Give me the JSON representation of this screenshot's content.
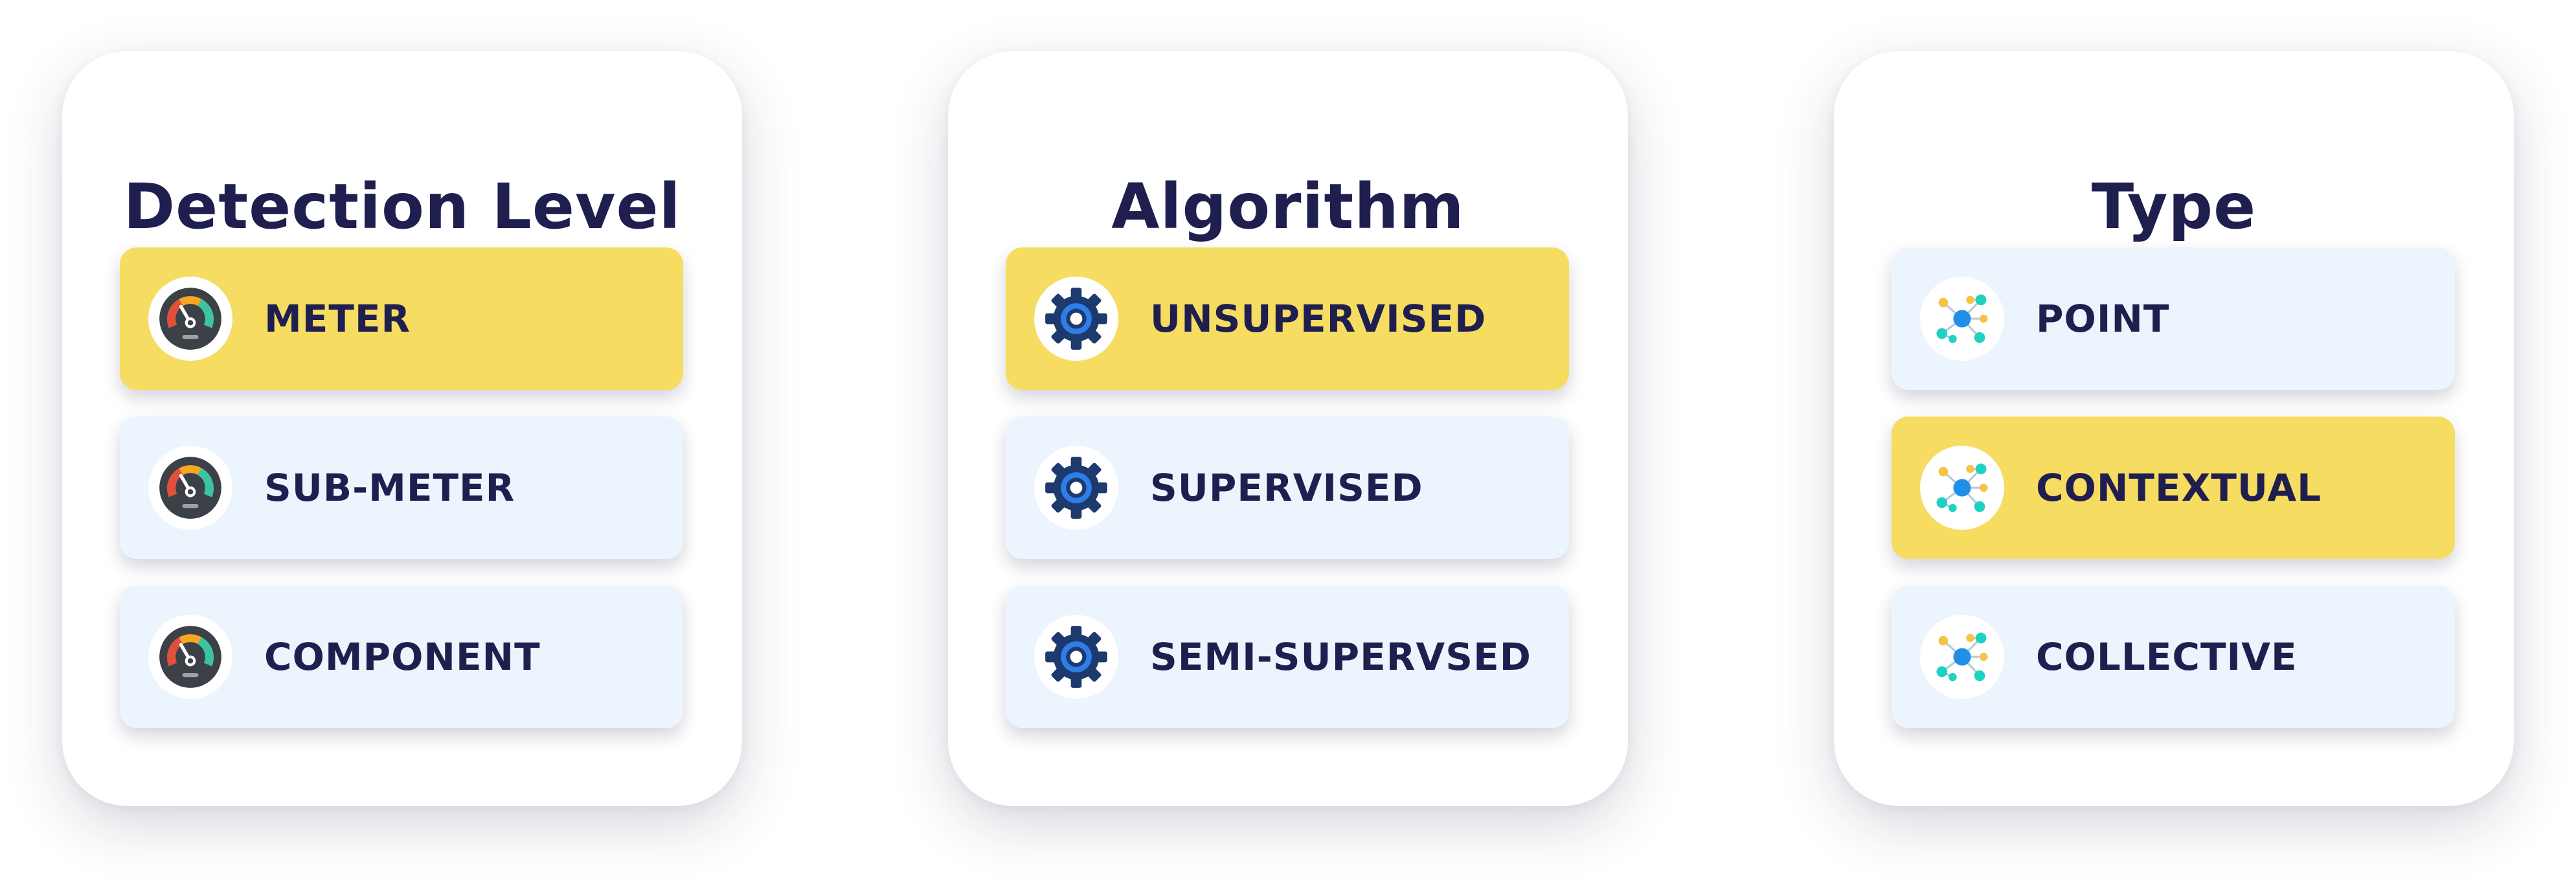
{
  "colors": {
    "title": "#1f1f4f",
    "selected_bg": "#f7dc62",
    "unselected_bg": "#ecf4fd"
  },
  "cards": [
    {
      "title": "Detection Level",
      "icon": "speedometer-icon",
      "options": [
        {
          "label": "METER",
          "selected": true
        },
        {
          "label": "SUB-METER",
          "selected": false
        },
        {
          "label": "COMPONENT",
          "selected": false
        }
      ]
    },
    {
      "title": "Algorithm",
      "icon": "gear-icon",
      "options": [
        {
          "label": "UNSUPERVISED",
          "selected": true
        },
        {
          "label": "SUPERVISED",
          "selected": false
        },
        {
          "label": "SEMI-SUPERVSED",
          "selected": false
        }
      ]
    },
    {
      "title": "Type",
      "icon": "network-nodes-icon",
      "options": [
        {
          "label": "POINT",
          "selected": false
        },
        {
          "label": "CONTEXTUAL",
          "selected": true
        },
        {
          "label": "COLLECTIVE",
          "selected": false
        }
      ]
    }
  ]
}
